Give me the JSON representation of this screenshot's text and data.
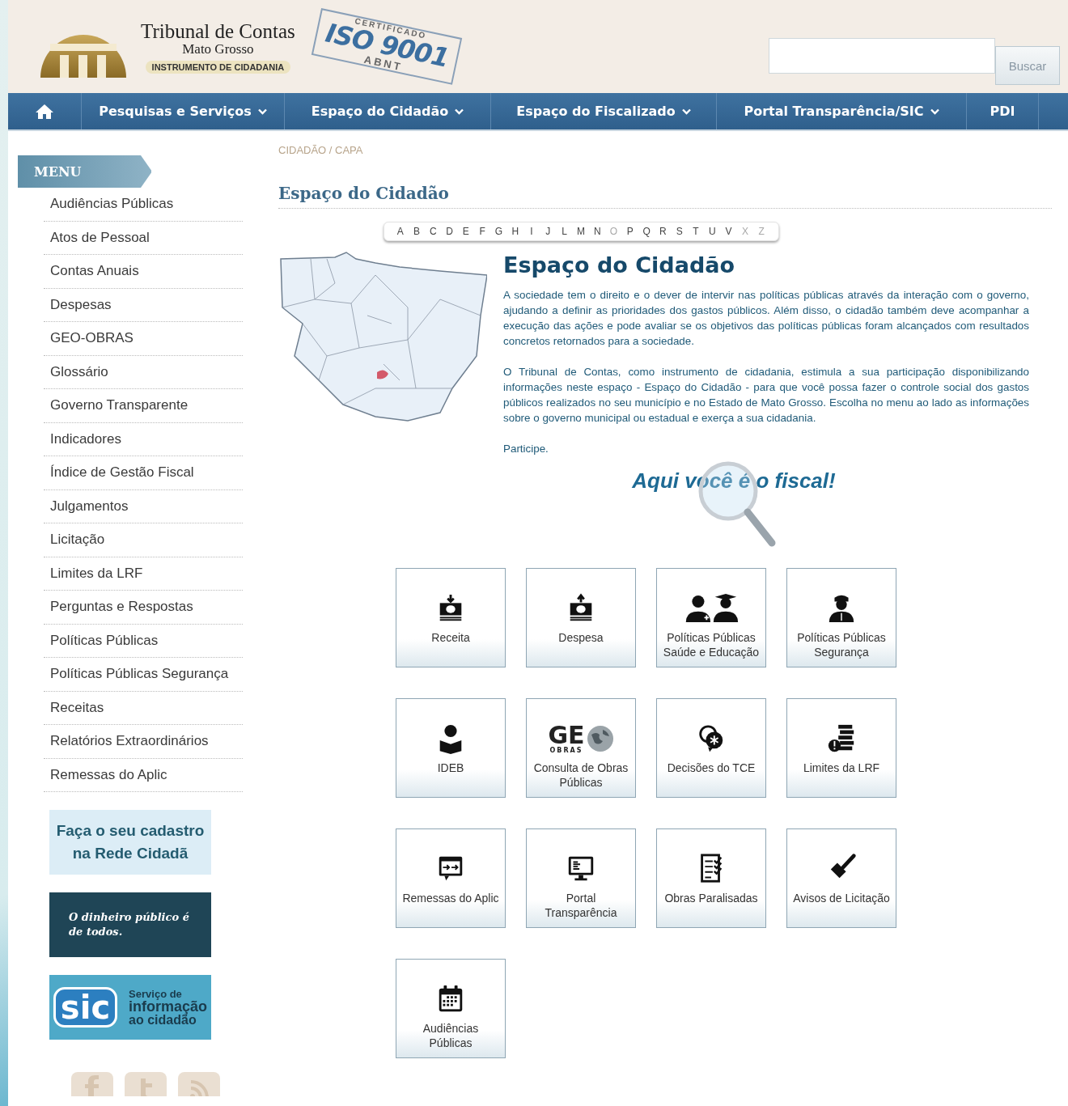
{
  "header": {
    "org_name": "Tribunal de Contas",
    "org_state": "Mato Grosso",
    "tagline": "INSTRUMENTO DE CIDADANIA",
    "certificate": {
      "top": "CERTIFICADO",
      "main": "ISO 9001",
      "bottom": "ABNT"
    },
    "search": {
      "button": "Buscar"
    }
  },
  "nav": [
    {
      "label": "Pesquisas e Serviços",
      "dropdown": true
    },
    {
      "label": "Espaço do Cidadão",
      "dropdown": true
    },
    {
      "label": "Espaço do Fiscalizado",
      "dropdown": true
    },
    {
      "label": "Portal Transparência/SIC",
      "dropdown": true
    },
    {
      "label": "PDI",
      "dropdown": false
    }
  ],
  "sidebar": {
    "title": "MENU",
    "items": [
      "Audiências Públicas",
      "Atos de Pessoal",
      "Contas Anuais",
      "Despesas",
      "GEO-OBRAS",
      "Glossário",
      "Governo Transparente",
      "Indicadores",
      "Índice de Gestão Fiscal",
      "Julgamentos",
      "Licitação",
      "Limites da LRF",
      "Perguntas e Respostas",
      "Políticas Públicas",
      "Políticas Públicas Segurança",
      "Receitas",
      "Relatórios Extraordinários",
      "Remessas do Aplic"
    ],
    "banners": [
      {
        "kind": "cadastro",
        "text": "Faça o seu cadastro na Rede Cidadã"
      },
      {
        "kind": "dinheiro",
        "text": "O dinheiro público é de todos."
      },
      {
        "kind": "sic",
        "logo": "sic",
        "lines": [
          "Serviço de",
          "informação",
          "ao cidadão"
        ]
      }
    ]
  },
  "breadcrumb": "CIDADÃO / CAPA",
  "page_title": "Espaço do Cidadão",
  "alphabet": [
    {
      "letter": "A",
      "disabled": false
    },
    {
      "letter": "B",
      "disabled": false
    },
    {
      "letter": "C",
      "disabled": false
    },
    {
      "letter": "D",
      "disabled": false
    },
    {
      "letter": "E",
      "disabled": false
    },
    {
      "letter": "F",
      "disabled": false
    },
    {
      "letter": "G",
      "disabled": false
    },
    {
      "letter": "H",
      "disabled": false
    },
    {
      "letter": "I",
      "disabled": false
    },
    {
      "letter": "J",
      "disabled": false
    },
    {
      "letter": "L",
      "disabled": false
    },
    {
      "letter": "M",
      "disabled": false
    },
    {
      "letter": "N",
      "disabled": false
    },
    {
      "letter": "O",
      "disabled": true
    },
    {
      "letter": "P",
      "disabled": false
    },
    {
      "letter": "Q",
      "disabled": false
    },
    {
      "letter": "R",
      "disabled": false
    },
    {
      "letter": "S",
      "disabled": false
    },
    {
      "letter": "T",
      "disabled": false
    },
    {
      "letter": "U",
      "disabled": false
    },
    {
      "letter": "V",
      "disabled": false
    },
    {
      "letter": "X",
      "disabled": true
    },
    {
      "letter": "Z",
      "disabled": true
    }
  ],
  "intro": {
    "heading": "Espaço do Cidadão",
    "paragraphs": [
      "A sociedade tem o direito e o dever de intervir nas políticas públicas através da interação com o governo, ajudando a definir as prioridades dos gastos públicos. Além disso, o cidadão também deve acompanhar a execução das ações e pode avaliar se os objetivos das políticas públicas foram alcançados com resultados concretos retornados para a sociedade.",
      "O Tribunal de Contas, como instrumento de cidadania, estimula a sua participação disponibilizando informações neste espaço - Espaço do Cidadão - para que você possa fazer o controle social dos gastos públicos realizados no seu município e no Estado de Mato Grosso.  Escolha no menu ao lado as informações sobre o governo municipal ou estadual e exerça a sua cidadania.",
      "Participe."
    ],
    "slogan": "Aqui você é o fiscal!"
  },
  "tiles": [
    {
      "kind": "receita",
      "label": "Receita"
    },
    {
      "kind": "despesa",
      "label": "Despesa"
    },
    {
      "kind": "saude",
      "label": "Políticas Públicas Saúde e Educação"
    },
    {
      "kind": "seguranca",
      "label": "Políticas Públicas Segurança"
    },
    {
      "kind": "ideb",
      "label": "IDEB"
    },
    {
      "kind": "geo",
      "label": "Consulta de Obras Públicas",
      "logo": "GE",
      "logo_sub": "OBRAS"
    },
    {
      "kind": "decisoes",
      "label": "Decisões do TCE"
    },
    {
      "kind": "limites",
      "label": "Limites da LRF"
    },
    {
      "kind": "remessas",
      "label": "Remessas do Aplic"
    },
    {
      "kind": "portal",
      "label": "Portal Transparência"
    },
    {
      "kind": "obras",
      "label": "Obras Paralisadas"
    },
    {
      "kind": "avisos",
      "label": "Avisos de Licitação"
    },
    {
      "kind": "audiencias",
      "label": "Audiências Públicas"
    }
  ],
  "social": [
    {
      "kind": "facebook"
    },
    {
      "kind": "twitter"
    },
    {
      "kind": "rss"
    }
  ]
}
